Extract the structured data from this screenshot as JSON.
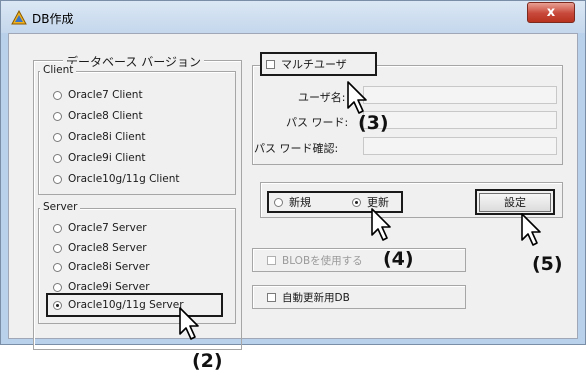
{
  "window": {
    "title": "DB作成",
    "close_label": "x"
  },
  "version_group": {
    "legend": "データベース バージョン",
    "client": {
      "legend": "Client",
      "options": [
        "Oracle7 Client",
        "Oracle8 Client",
        "Oracle8i Client",
        "Oracle9i Client",
        "Oracle10g/11g Client"
      ]
    },
    "server": {
      "legend": "Server",
      "options": [
        "Oracle7 Server",
        "Oracle8 Server",
        "Oracle8i Server",
        "Oracle9i Server",
        "Oracle10g/11g Server"
      ],
      "selected": "Oracle10g/11g Server"
    }
  },
  "multiuser": {
    "checkbox_label": "マルチユーザ",
    "checked": false,
    "username_label": "ユーザ名:",
    "password_label": "パス ワード:",
    "password_confirm_label": "パス ワード確認:",
    "username_value": "",
    "password_value": "",
    "password_confirm_value": ""
  },
  "mode": {
    "new_label": "新規",
    "update_label": "更新",
    "selected": "更新"
  },
  "settings_button": "設定",
  "blob_checkbox": {
    "label": "BLOBを使用する",
    "enabled": false,
    "checked": false
  },
  "autoupdate_checkbox": {
    "label": "自動更新用DB",
    "checked": false
  },
  "callouts": [
    "(2)",
    "(3)",
    "(4)",
    "(5)"
  ]
}
